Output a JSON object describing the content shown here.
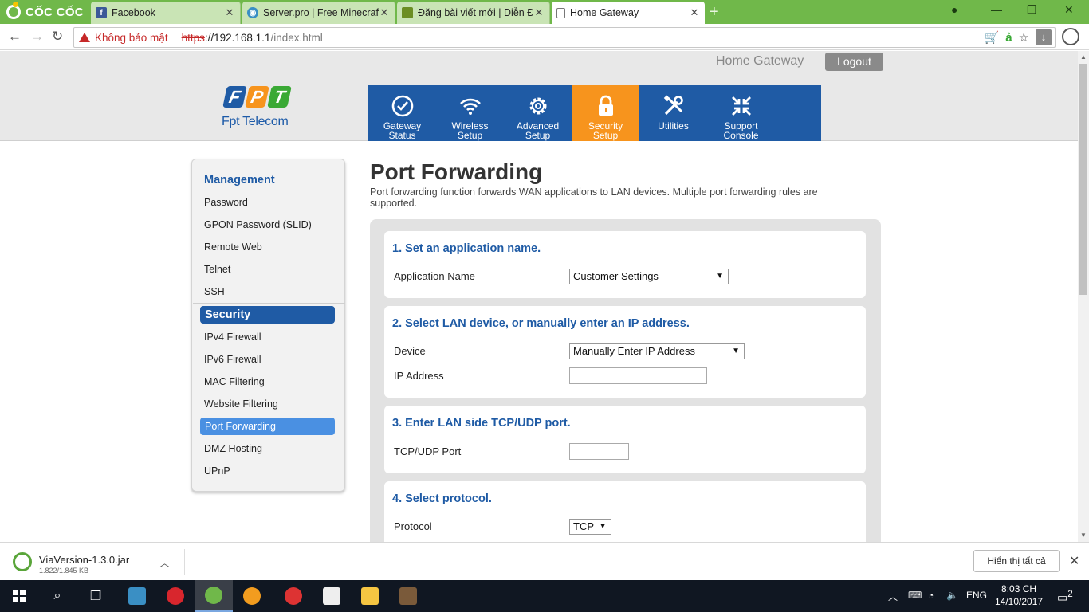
{
  "browser": {
    "brand": "CỐC CỐC",
    "tabs": [
      {
        "label": "Facebook",
        "icon": "facebook-icon",
        "color": "#3b5998"
      },
      {
        "label": "Server.pro | Free Minecraft",
        "icon": "serverpro-icon",
        "color": "#3a8fc4"
      },
      {
        "label": "Đăng bài viết mới | Diễn Đ",
        "icon": "forum-icon",
        "color": "#6b8e23"
      },
      {
        "label": "Home Gateway",
        "icon": "page-icon",
        "color": "#ffffff"
      }
    ],
    "security_warning": "Không bảo mật",
    "url_scheme": "https",
    "url_host": "://192.168.1.1",
    "url_path": "/index.html"
  },
  "header": {
    "title": "Home Gateway",
    "logout_label": "Logout",
    "logo_letters": [
      "F",
      "P",
      "T"
    ],
    "logo_colors": [
      "#1f5ba5",
      "#f7941d",
      "#3aa935"
    ],
    "logo_sub": "Fpt Telecom"
  },
  "nav": [
    {
      "line1": "Gateway",
      "line2": "Status",
      "icon": "check-circle-icon"
    },
    {
      "line1": "Wireless",
      "line2": "Setup",
      "icon": "wifi-icon"
    },
    {
      "line1": "Advanced",
      "line2": "Setup",
      "icon": "gear-icon"
    },
    {
      "line1": "Security",
      "line2": "Setup",
      "icon": "lock-icon",
      "active": true
    },
    {
      "line1": "Utilities",
      "line2": "",
      "icon": "tools-icon"
    },
    {
      "line1": "Support",
      "line2": "Console",
      "icon": "arrows-in-icon"
    }
  ],
  "sidebar": {
    "management_title": "Management",
    "management_items": [
      "Password",
      "GPON Password (SLID)",
      "Remote Web",
      "Telnet",
      "SSH"
    ],
    "security_title": "Security",
    "security_items": [
      "IPv4 Firewall",
      "IPv6 Firewall",
      "MAC Filtering",
      "Website Filtering",
      "Port Forwarding",
      "DMZ Hosting",
      "UPnP"
    ]
  },
  "page": {
    "title": "Port Forwarding",
    "description": "Port forwarding function forwards WAN applications to LAN devices. Multiple port forwarding rules are supported.",
    "step1_title": "1. Set an application name.",
    "app_name_label": "Application Name",
    "app_name_value": "Customer Settings",
    "step2_title": "2. Select LAN device, or manually enter an IP address.",
    "device_label": "Device",
    "device_value": "Manually Enter IP Address",
    "ip_label": "IP Address",
    "ip_value": "",
    "step3_title": "3. Enter LAN side TCP/UDP port.",
    "port_label": "TCP/UDP Port",
    "port_value": "",
    "step4_title": "4. Select protocol.",
    "protocol_label": "Protocol",
    "protocol_value": "TCP"
  },
  "download": {
    "filename": "ViaVersion-1.3.0.jar",
    "size": "1.822/1.845 KB",
    "show_all": "Hiển thị tất cả"
  },
  "taskbar": {
    "lang": "ENG",
    "time": "8:03 CH",
    "date": "14/10/2017",
    "notifications": "2"
  }
}
